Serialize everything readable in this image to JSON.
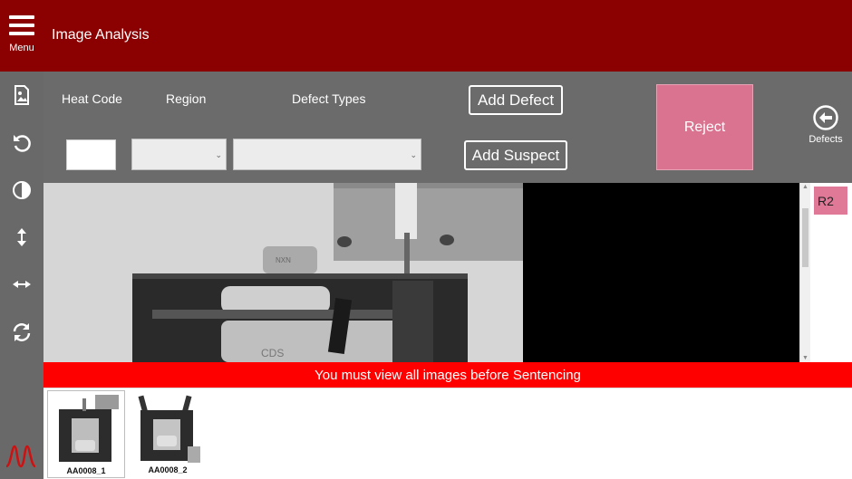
{
  "header": {
    "menu_label": "Menu",
    "title": "Image Analysis",
    "background_color": "#8b0000"
  },
  "toolbar": {
    "tools": [
      {
        "name": "image-icon"
      },
      {
        "name": "rotate-icon"
      },
      {
        "name": "contrast-icon"
      },
      {
        "name": "flip-vertical-icon"
      },
      {
        "name": "flip-horizontal-icon"
      },
      {
        "name": "refresh-icon"
      }
    ],
    "logo": "waveform-logo"
  },
  "controls": {
    "heat_code_label": "Heat Code",
    "region_label": "Region",
    "defect_types_label": "Defect Types",
    "heat_code_value": "",
    "region_value": "",
    "defect_type_value": "",
    "add_defect_label": "Add Defect",
    "add_suspect_label": "Add Suspect",
    "reject_label": "Reject",
    "reject_color": "#d9738f",
    "defects_label": "Defects"
  },
  "viewer": {
    "xray_text": "CDS",
    "xray_marking": "NXN",
    "region_tags": [
      "R2"
    ]
  },
  "warning": {
    "text": "You must view all images before Sentencing",
    "color": "#ff0000"
  },
  "thumbnails": [
    {
      "label": "AA0008_1",
      "selected": true
    },
    {
      "label": "AA0008_2",
      "selected": false
    }
  ]
}
